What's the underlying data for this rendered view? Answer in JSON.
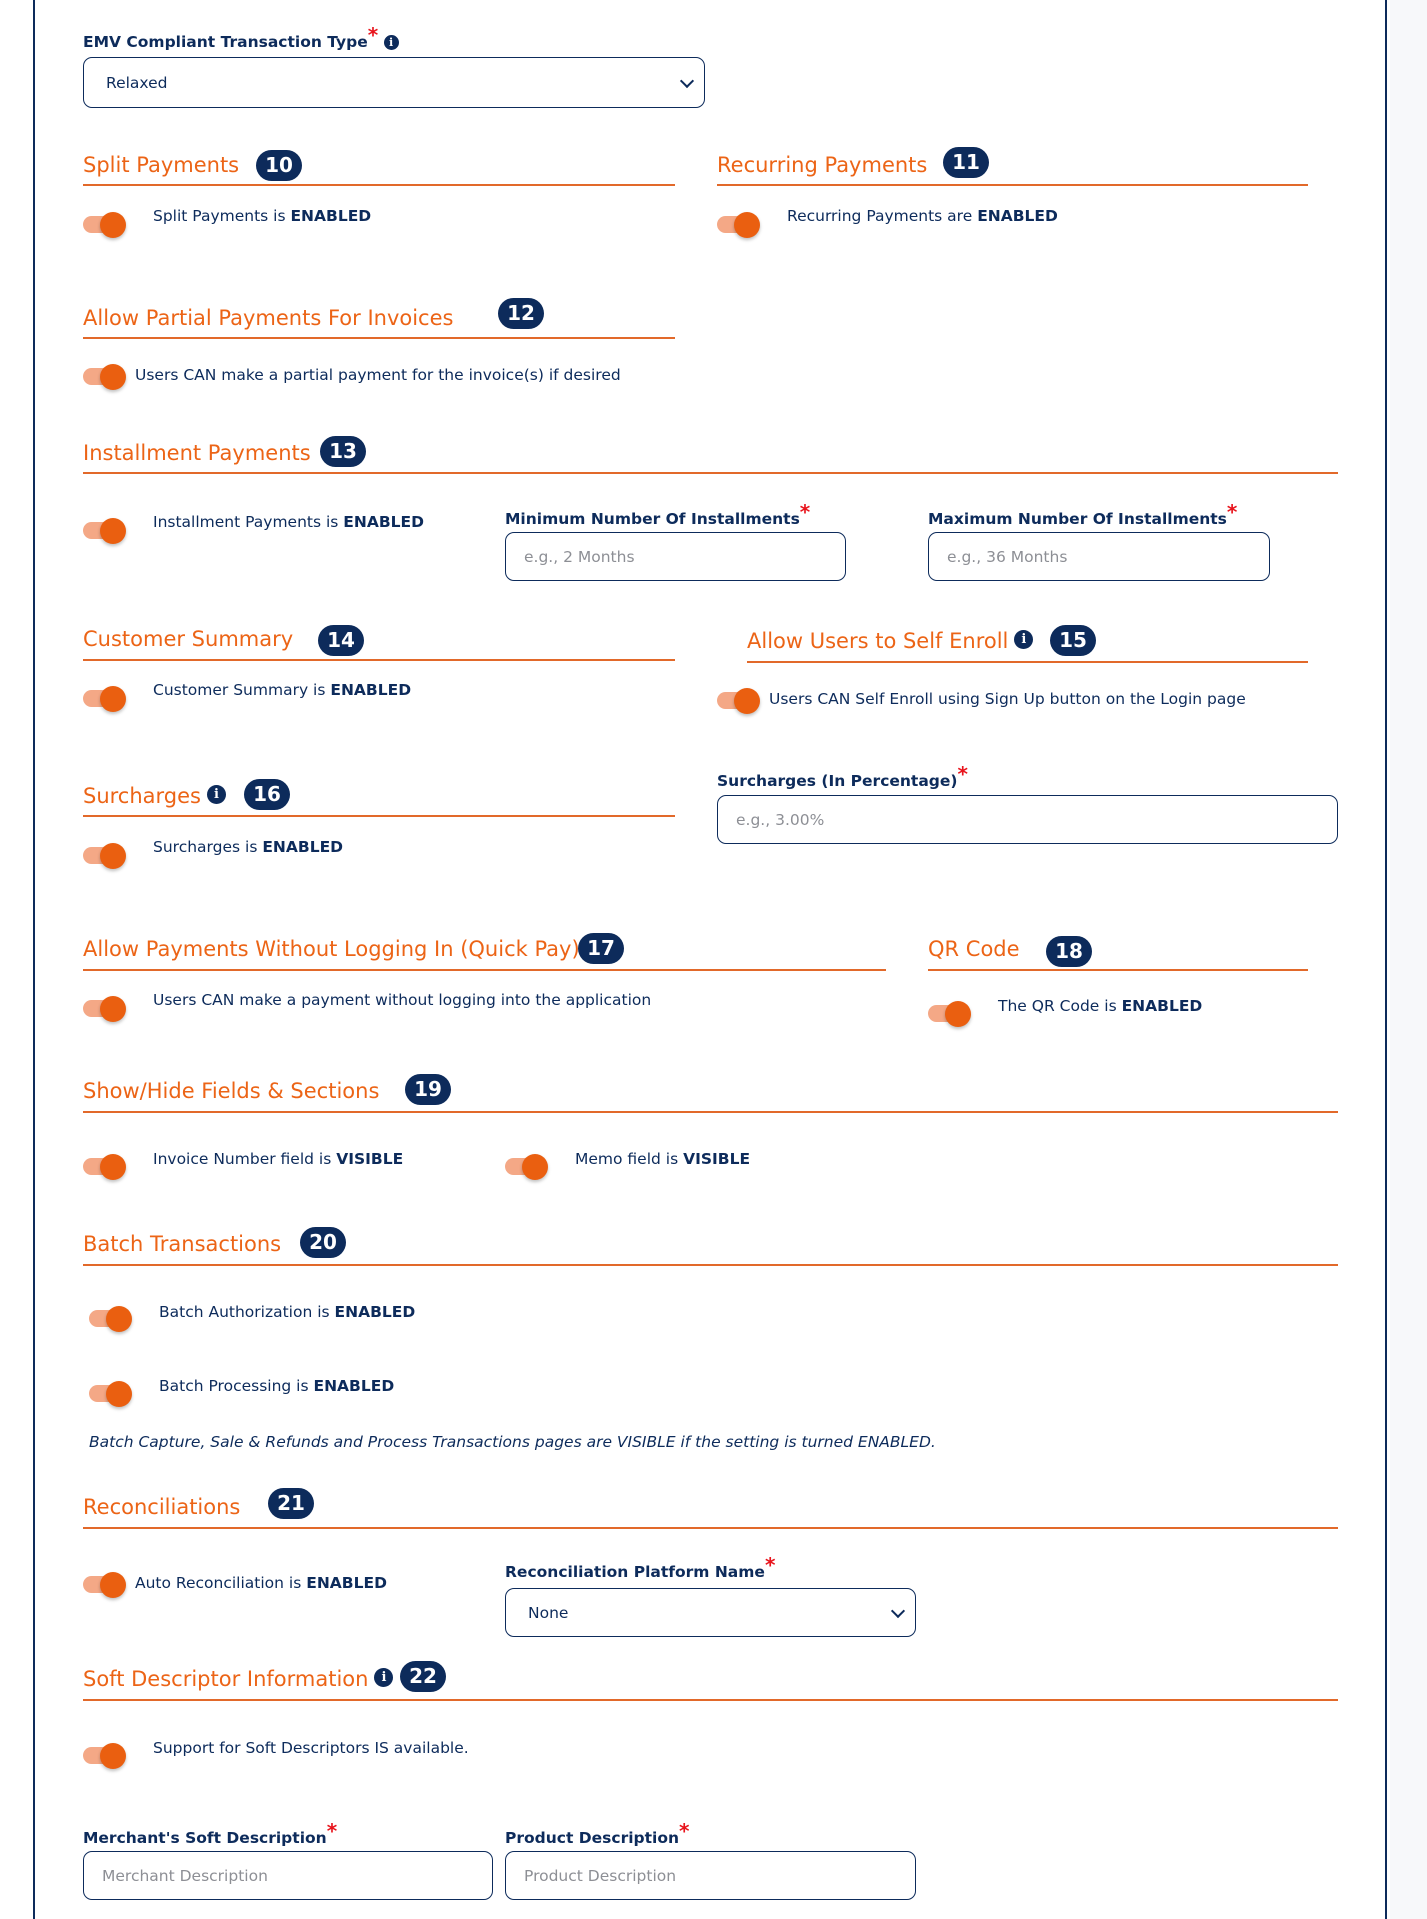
{
  "emv": {
    "label": "EMV Compliant Transaction Type",
    "required_mark": "*",
    "info_icon": "i",
    "selected": "Relaxed"
  },
  "sections": {
    "split": {
      "title": "Split Payments",
      "badge": "10",
      "toggle_text": "Split Payments is ",
      "toggle_state": "ENABLED",
      "on": true
    },
    "recurring": {
      "title": "Recurring Payments",
      "badge": "11",
      "toggle_text": "Recurring Payments are ",
      "toggle_state": "ENABLED",
      "on": true
    },
    "partial": {
      "title": "Allow Partial Payments For Invoices",
      "badge": "12",
      "toggle_text": "Users CAN make a partial payment for the invoice(s) if desired",
      "on": true
    },
    "installment": {
      "title": "Installment Payments",
      "badge": "13",
      "toggle_text": "Installment Payments is ",
      "toggle_state": "ENABLED",
      "on": true,
      "min_label": "Minimum Number Of Installments",
      "min_placeholder": "e.g., 2 Months",
      "min_value": "",
      "max_label": "Maximum Number Of Installments",
      "max_placeholder": "e.g., 36 Months",
      "max_value": ""
    },
    "customer_summary": {
      "title": "Customer Summary",
      "badge": "14",
      "toggle_text": "Customer Summary is ",
      "toggle_state": "ENABLED",
      "on": true
    },
    "self_enroll": {
      "title": "Allow Users to Self Enroll",
      "badge": "15",
      "info_icon": "i",
      "toggle_text": "Users CAN Self Enroll using Sign Up button on the Login page",
      "on": true
    },
    "surcharges": {
      "title": "Surcharges",
      "badge": "16",
      "info_icon": "i",
      "toggle_text": "Surcharges is ",
      "toggle_state": "ENABLED",
      "on": true,
      "pct_label": "Surcharges (In Percentage)",
      "pct_placeholder": "e.g., 3.00%",
      "pct_value": ""
    },
    "quick_pay": {
      "title": "Allow Payments Without Logging In (Quick Pay)",
      "badge": "17",
      "toggle_text": "Users CAN make a payment without logging into the application",
      "on": true
    },
    "qr_code": {
      "title": "QR Code",
      "badge": "18",
      "toggle_text": "The QR Code is ",
      "toggle_state": "ENABLED",
      "on": true
    },
    "show_hide": {
      "title": "Show/Hide Fields & Sections",
      "badge": "19",
      "invoice_text": "Invoice Number field is ",
      "invoice_state": "VISIBLE",
      "invoice_on": true,
      "memo_text": "Memo field is ",
      "memo_state": "VISIBLE",
      "memo_on": true
    },
    "batch": {
      "title": "Batch Transactions",
      "badge": "20",
      "auth_text": "Batch Authorization is ",
      "auth_state": "ENABLED",
      "auth_on": true,
      "proc_text": "Batch Processing is ",
      "proc_state": "ENABLED",
      "proc_on": true,
      "note": "Batch Capture, Sale & Refunds and Process Transactions pages are VISIBLE if the setting is turned ENABLED."
    },
    "reconciliations": {
      "title": "Reconciliations",
      "badge": "21",
      "toggle_text": "Auto Reconciliation is ",
      "toggle_state": "ENABLED",
      "on": true,
      "platform_label": "Reconciliation Platform Name",
      "platform_selected": "None"
    },
    "soft_descriptor": {
      "title": "Soft Descriptor Information",
      "badge": "22",
      "info_icon": "i",
      "toggle_text": "Support for Soft Descriptors IS available.",
      "on": true,
      "merchant_label": "Merchant's Soft Description",
      "merchant_placeholder": "Merchant Description",
      "merchant_value": "",
      "product_label": "Product Description",
      "product_placeholder": "Product Description",
      "product_value": ""
    }
  },
  "colors": {
    "accent_orange": "#ec6416",
    "navy": "#0d2b5b",
    "required_red": "#e8141c",
    "toggle_track": "#f4a886"
  }
}
